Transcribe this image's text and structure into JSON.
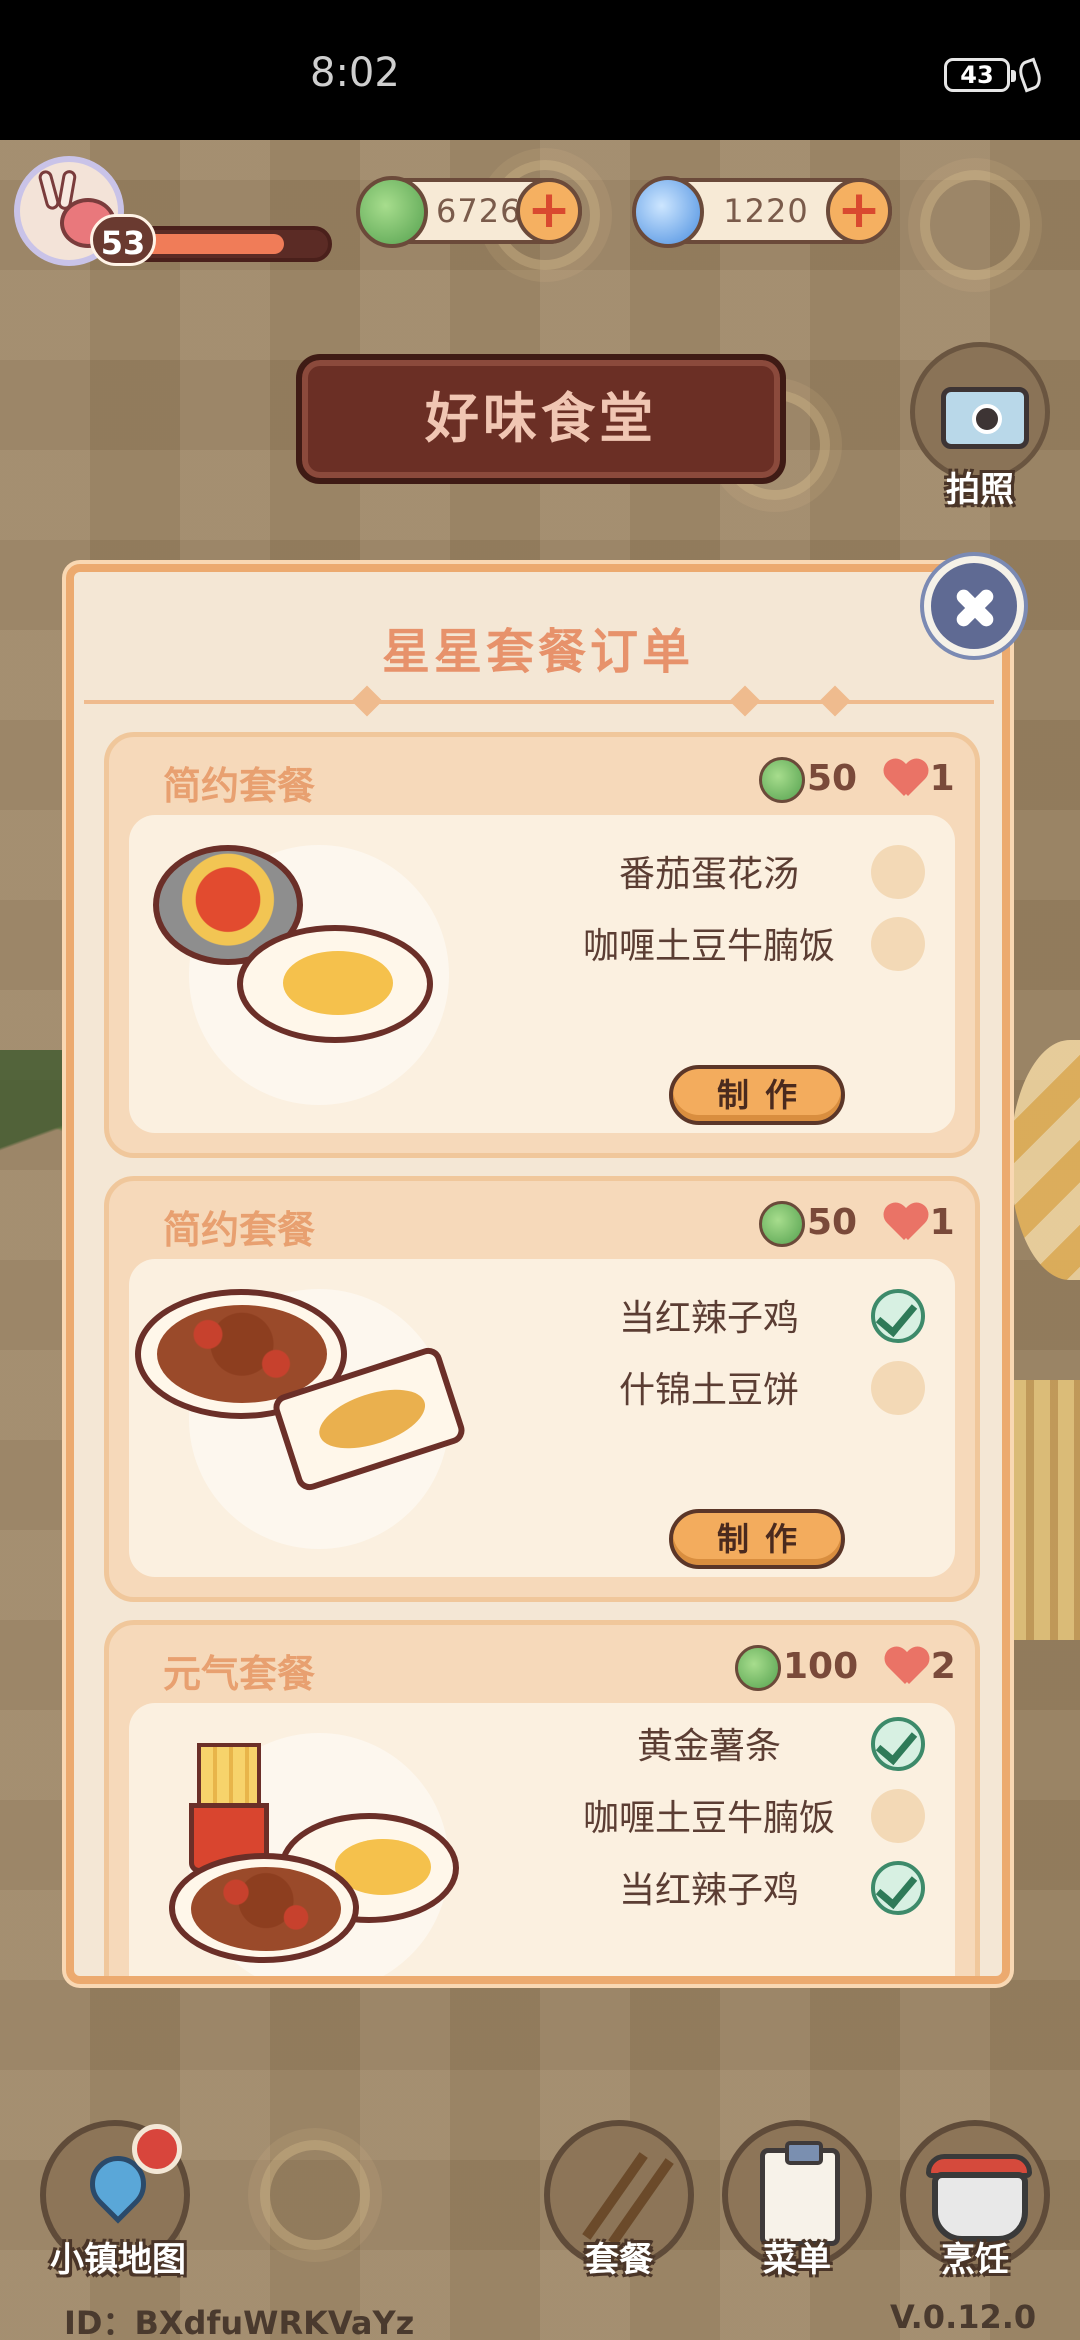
{
  "status_bar": {
    "time": "8:02",
    "battery": "43"
  },
  "hud": {
    "player_level": "53",
    "level_progress": 0.82,
    "coins": "6726",
    "gems": "1220",
    "coin_icon": "clover-coin-icon",
    "gem_icon": "swirl-gem-icon"
  },
  "restaurant_sign": "好味食堂",
  "camera": {
    "label": "拍照"
  },
  "panel": {
    "title": "星星套餐订单",
    "orders": [
      {
        "title": "简约套餐",
        "coin_reward": "50",
        "heart_reward": "1",
        "items": [
          {
            "name": "番茄蛋花汤",
            "done": false
          },
          {
            "name": "咖喱土豆牛腩饭",
            "done": false
          }
        ],
        "make_label": "制作"
      },
      {
        "title": "简约套餐",
        "coin_reward": "50",
        "heart_reward": "1",
        "items": [
          {
            "name": "当红辣子鸡",
            "done": true
          },
          {
            "name": "什锦土豆饼",
            "done": false
          }
        ],
        "make_label": "制作"
      },
      {
        "title": "元气套餐",
        "coin_reward": "100",
        "heart_reward": "2",
        "items": [
          {
            "name": "黄金薯条",
            "done": true
          },
          {
            "name": "咖喱土豆牛腩饭",
            "done": false
          },
          {
            "name": "当红辣子鸡",
            "done": true
          }
        ]
      }
    ]
  },
  "bottom_nav": {
    "map": "小镇地图",
    "combo": "套餐",
    "menu": "菜单",
    "cook": "烹饪"
  },
  "footer": {
    "id": "ID：BXdfuWRKVaYz",
    "version": "V.0.12.0"
  }
}
